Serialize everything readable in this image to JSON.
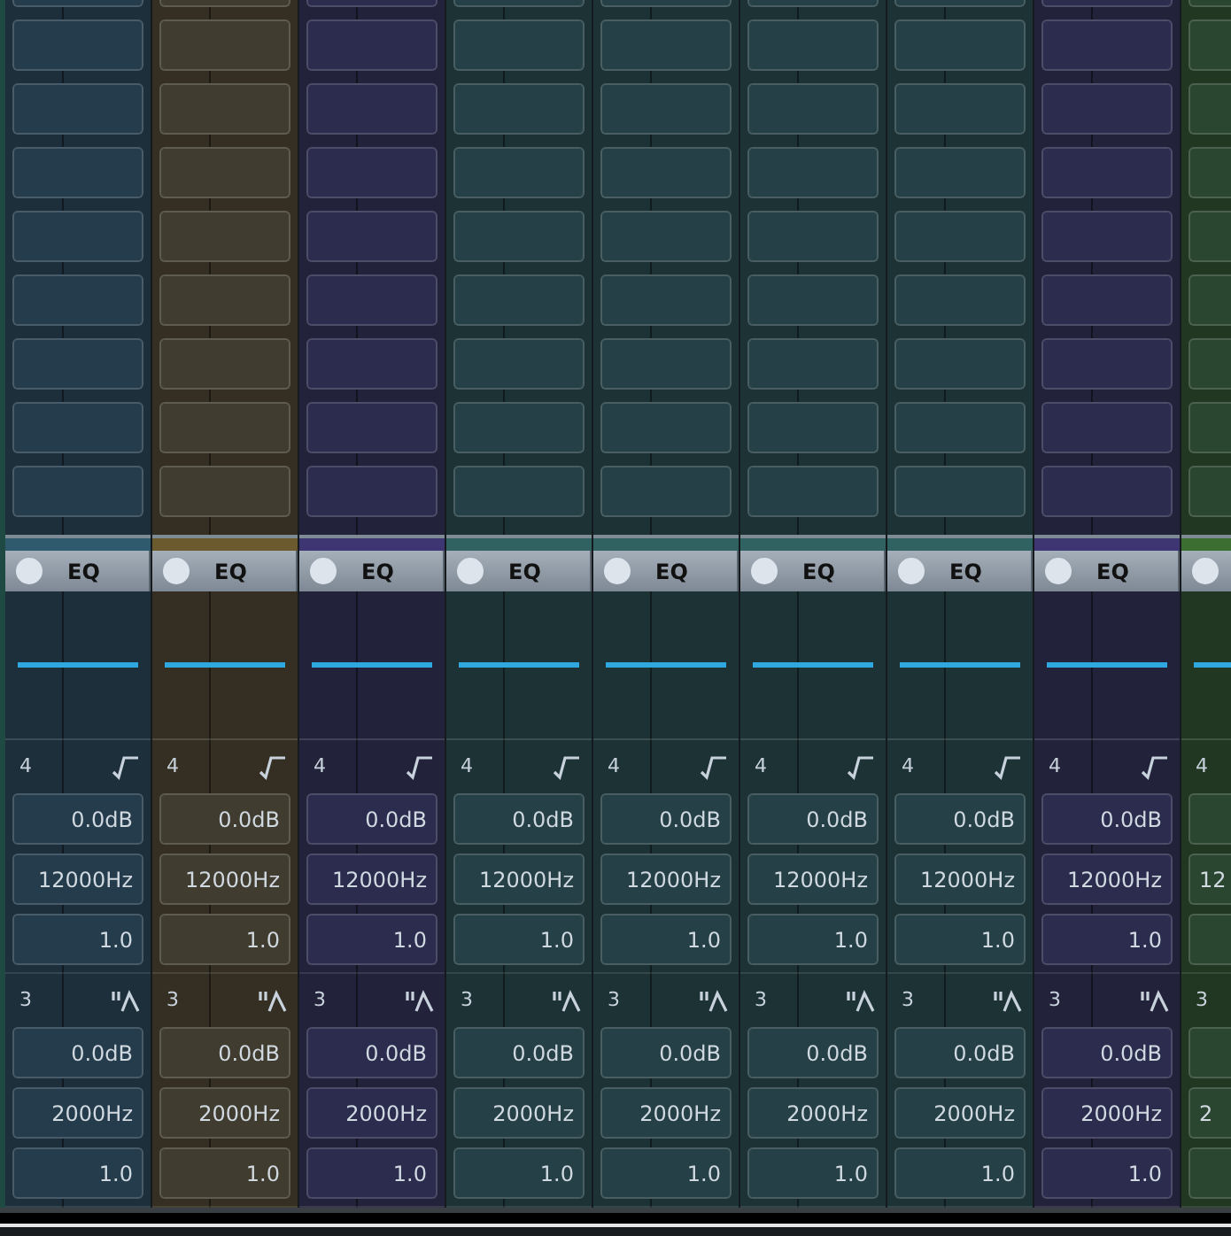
{
  "channels": [
    {
      "color": "#2f5a6e",
      "eq_label": "EQ",
      "bands": [
        {
          "number": "4",
          "kind": "shelf",
          "gain": "0.0dB",
          "freq": "12000Hz",
          "q": "1.0"
        },
        {
          "number": "3",
          "kind": "peak",
          "gain": "0.0dB",
          "freq": "2000Hz",
          "q": "1.0"
        }
      ]
    },
    {
      "color": "#6b5a2e",
      "eq_label": "EQ",
      "bands": [
        {
          "number": "4",
          "kind": "shelf",
          "gain": "0.0dB",
          "freq": "12000Hz",
          "q": "1.0"
        },
        {
          "number": "3",
          "kind": "peak",
          "gain": "0.0dB",
          "freq": "2000Hz",
          "q": "1.0"
        }
      ]
    },
    {
      "color": "#3e3672",
      "eq_label": "EQ",
      "bands": [
        {
          "number": "4",
          "kind": "shelf",
          "gain": "0.0dB",
          "freq": "12000Hz",
          "q": "1.0"
        },
        {
          "number": "3",
          "kind": "peak",
          "gain": "0.0dB",
          "freq": "2000Hz",
          "q": "1.0"
        }
      ]
    },
    {
      "color": "#2f6260",
      "eq_label": "EQ",
      "bands": [
        {
          "number": "4",
          "kind": "shelf",
          "gain": "0.0dB",
          "freq": "12000Hz",
          "q": "1.0"
        },
        {
          "number": "3",
          "kind": "peak",
          "gain": "0.0dB",
          "freq": "2000Hz",
          "q": "1.0"
        }
      ]
    },
    {
      "color": "#2f6260",
      "eq_label": "EQ",
      "bands": [
        {
          "number": "4",
          "kind": "shelf",
          "gain": "0.0dB",
          "freq": "12000Hz",
          "q": "1.0"
        },
        {
          "number": "3",
          "kind": "peak",
          "gain": "0.0dB",
          "freq": "2000Hz",
          "q": "1.0"
        }
      ]
    },
    {
      "color": "#2f6260",
      "eq_label": "EQ",
      "bands": [
        {
          "number": "4",
          "kind": "shelf",
          "gain": "0.0dB",
          "freq": "12000Hz",
          "q": "1.0"
        },
        {
          "number": "3",
          "kind": "peak",
          "gain": "0.0dB",
          "freq": "2000Hz",
          "q": "1.0"
        }
      ]
    },
    {
      "color": "#2f6260",
      "eq_label": "EQ",
      "bands": [
        {
          "number": "4",
          "kind": "shelf",
          "gain": "0.0dB",
          "freq": "12000Hz",
          "q": "1.0"
        },
        {
          "number": "3",
          "kind": "peak",
          "gain": "0.0dB",
          "freq": "2000Hz",
          "q": "1.0"
        }
      ]
    },
    {
      "color": "#3e3672",
      "eq_label": "EQ",
      "bands": [
        {
          "number": "4",
          "kind": "shelf",
          "gain": "0.0dB",
          "freq": "12000Hz",
          "q": "1.0"
        },
        {
          "number": "3",
          "kind": "peak",
          "gain": "0.0dB",
          "freq": "2000Hz",
          "q": "1.0"
        }
      ]
    },
    {
      "color": "#3b6e30",
      "clipped": true,
      "bands": [
        {
          "number": "4",
          "freq": "12"
        },
        {
          "number": "3",
          "freq": "2"
        }
      ]
    }
  ]
}
